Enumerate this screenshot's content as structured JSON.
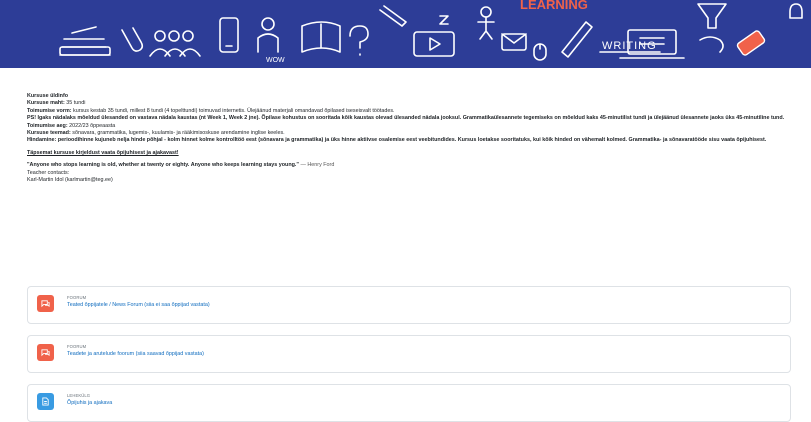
{
  "banner": {
    "word_learning": "LEARNING",
    "word_writing": "WRITING",
    "word_wow": "WOW",
    "colors": {
      "background": "#2d3d97",
      "line": "#ffffff",
      "accent": "#f0624a"
    }
  },
  "summary": {
    "heading": "Kursuse üldinfo",
    "rows": [
      {
        "label": "Kursuse maht:",
        "value": "35 tundi"
      },
      {
        "label": "Toimumise vorm:",
        "value": "kursus kestab 35 tundi, millest 8 tundi (4 topelttundi) toimuvad internetis. Ülejäänud materjali omandavad õpilased iseseisvalt töötades."
      }
    ],
    "ps_text": "PS! Igaks nädalaks mõeldud ülesanded on vastava nädala kaustas (nt Week 1, Week 2 jne). Õpilase kohustus on sooritada kõik kaustas olevad ülesanded nädala jooksul. Grammatikaülesannete tegemiseks on mõeldud kaks 45-minutilist tundi ja ülejäänud ülesannete jaoks üks 45-minutiline tund.",
    "time_label": "Toimumise aeg:",
    "time_value": "2022/23 õppeaasta",
    "topics_label": "Kursuse teemad:",
    "topics_value": "sõnavara, grammatika, lugemis-, kuulamis- ja rääkimisoskuse arendamine inglise keeles.",
    "grading_label": "Hindamine:",
    "grading_value": "perioodihinne kujuneb nelja hinde põhjal - kolm hinnet kolme kontrolltöö eest (sõnavara ja grammatika) ja üks hinne aktiivse osalemise eest veebitundides. Kursus loetakse sooritatuks, kui kõik hinded on vähemalt kolmed. Grammatika- ja sõnavaratööde sisu vaata õpijuhisest.",
    "details_link": "Täpsemat kursuse kirjeldust vaata õpijuhisest ja ajakavast!",
    "quote": "\"Anyone who stops learning is old, whether at twenty or eighty. Anyone who keeps learning stays young.\"",
    "quote_author": "— Henry Ford",
    "contacts_label": "Teacher contacts:",
    "contact": "Karl-Martin Idol (karlmartin@teg.ee)"
  },
  "activities": [
    {
      "kind": "FOORUM",
      "title": "Teated õppijatele / News Forum (siia ei saa õppijad vastata)",
      "icon": "forum-icon"
    },
    {
      "kind": "FOORUM",
      "title": "Teadete ja arutelude foorum (siia saavad õppijad vastata)",
      "icon": "forum-icon"
    },
    {
      "kind": "LEHEKÜLG",
      "title": "Õpijuhis ja ajakava",
      "icon": "page-icon"
    }
  ]
}
